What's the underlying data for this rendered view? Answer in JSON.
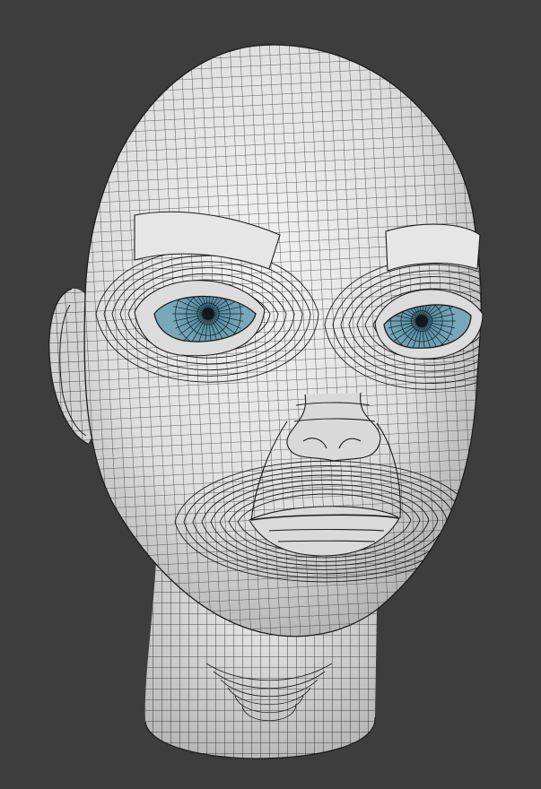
{
  "scene": {
    "subject": "head-mesh",
    "colors": {
      "background": "#3d3d3d",
      "skin": "#e4e4e4",
      "skin_shadow": "#b9b9b9",
      "wire": "#1c1c1c",
      "iris": "#6f9db0",
      "iris_dark": "#3f6f82",
      "pupil": "#0e1a20"
    }
  }
}
